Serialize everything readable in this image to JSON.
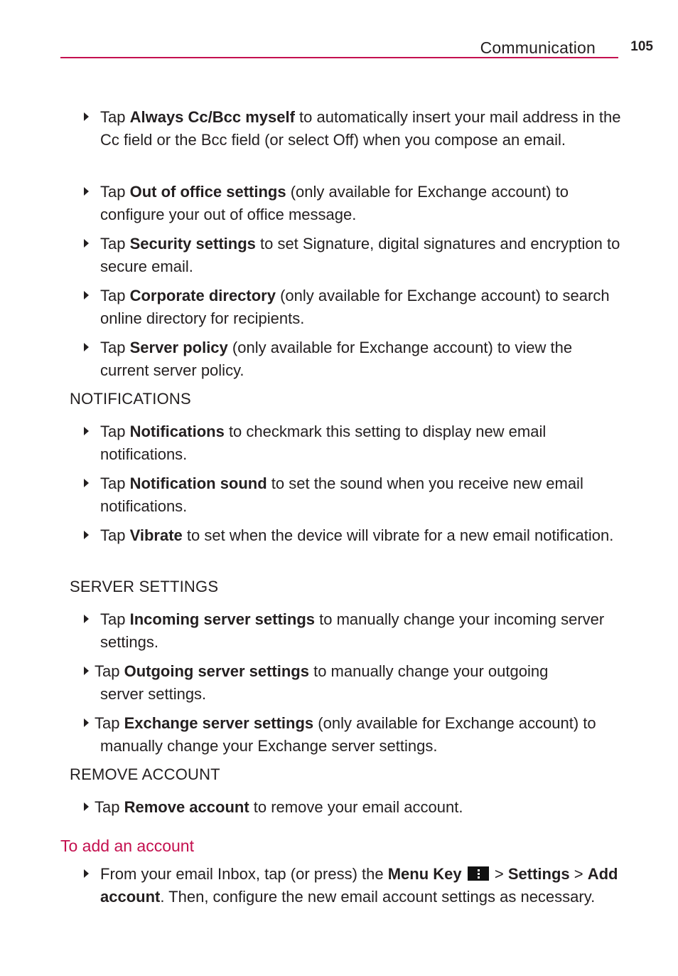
{
  "header": {
    "section_title": "Communication",
    "page_number": "105",
    "accent_color": "#c4104f"
  },
  "items_top": [
    {
      "pre": "Tap ",
      "bold": "Always Cc/Bcc myself",
      "post": " to automatically insert your mail address in the Cc field or the Bcc field (or select Off) when you compose an email."
    },
    {
      "pre": "Tap ",
      "bold": "Out of office settings",
      "post": " (only available for Exchange account) to configure your out of office message."
    },
    {
      "pre": "Tap ",
      "bold": "Security settings",
      "post": " to set Signature, digital signatures and encryption to secure email."
    },
    {
      "pre": "Tap ",
      "bold": "Corporate directory",
      "post": " (only available for Exchange account) to search online directory for recipients."
    },
    {
      "pre": "Tap ",
      "bold": "Server policy",
      "post": " (only available for Exchange account) to view the current server policy."
    }
  ],
  "notifications": {
    "heading": "NOTIFICATIONS",
    "items": [
      {
        "pre": "Tap ",
        "bold": "Notifications",
        "post": " to checkmark this setting to display new email notifications."
      },
      {
        "pre": "Tap ",
        "bold": "Notification sound",
        "post": " to set the sound when you receive new email notifications."
      },
      {
        "pre": "Tap ",
        "bold": "Vibrate",
        "post": " to set when the device will vibrate for a new email notification."
      }
    ]
  },
  "server_settings": {
    "heading": "SERVER SETTINGS",
    "items": [
      {
        "pre": "Tap ",
        "bold": "Incoming server settings",
        "post": " to manually change your incoming server settings."
      },
      {
        "pre": "Tap ",
        "bold": "Outgoing server settings",
        "post": " to manually change your outgoing",
        "cont": "server settings."
      },
      {
        "pre": "Tap ",
        "bold": "Exchange server settings",
        "post": " (only available for Exchange account) to",
        "cont": "manually change your Exchange server settings."
      }
    ]
  },
  "remove_account": {
    "heading": "REMOVE ACCOUNT",
    "items": [
      {
        "pre": "Tap ",
        "bold": "Remove account",
        "post": " to remove your email account."
      }
    ]
  },
  "add_account": {
    "heading": "To add an account",
    "step": {
      "pre": "From your email Inbox, tap (or press) the ",
      "bold1": "Menu Key",
      "icon": "menu-key-icon",
      "sep1": " > ",
      "bold2": "Settings",
      "sep2": " > ",
      "bold3": "Add account",
      "post": ". Then, configure the new email account settings as necessary."
    }
  }
}
